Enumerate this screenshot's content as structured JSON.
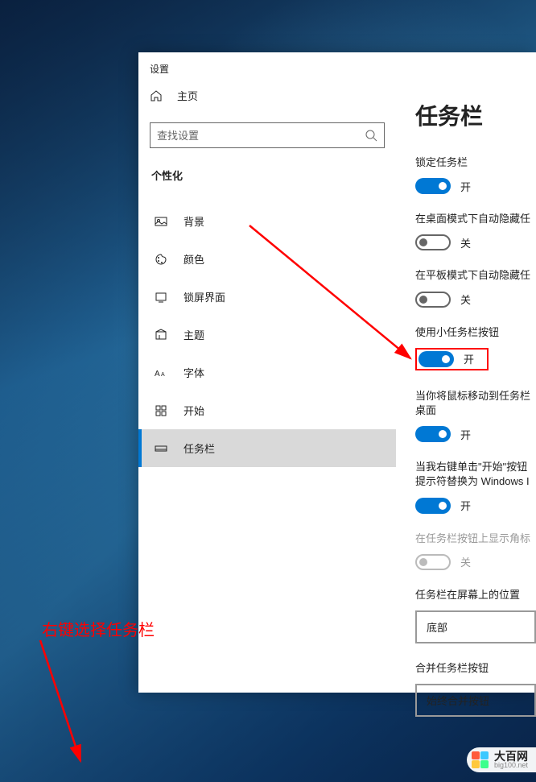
{
  "window": {
    "title": "设置"
  },
  "sidebar": {
    "home": "主页",
    "search_placeholder": "查找设置",
    "section": "个性化",
    "items": [
      {
        "label": "背景"
      },
      {
        "label": "颜色"
      },
      {
        "label": "锁屏界面"
      },
      {
        "label": "主题"
      },
      {
        "label": "字体"
      },
      {
        "label": "开始"
      },
      {
        "label": "任务栏"
      }
    ]
  },
  "content": {
    "title": "任务栏",
    "settings": [
      {
        "label": "锁定任务栏",
        "state": "on",
        "text": "开"
      },
      {
        "label": "在桌面模式下自动隐藏任",
        "state": "off",
        "text": "关"
      },
      {
        "label": "在平板模式下自动隐藏任",
        "state": "off",
        "text": "关"
      },
      {
        "label": "使用小任务栏按钮",
        "state": "on",
        "text": "开",
        "highlight": true
      },
      {
        "label": "当你将鼠标移动到任务栏桌面",
        "state": "on",
        "text": "开"
      },
      {
        "label": "当我右键单击\"开始\"按钮提示符替换为 Windows I",
        "state": "on",
        "text": "开"
      },
      {
        "label": "在任务栏按钮上显示角标",
        "state": "off",
        "text": "关",
        "disabled": true
      }
    ],
    "position": {
      "label": "任务栏在屏幕上的位置",
      "value": "底部"
    },
    "combine": {
      "label": "合并任务栏按钮",
      "value": "始终合并按钮"
    }
  },
  "annotation": {
    "text": "右键选择任务栏"
  },
  "watermark": {
    "main": "大百网",
    "sub": "big100.net"
  }
}
